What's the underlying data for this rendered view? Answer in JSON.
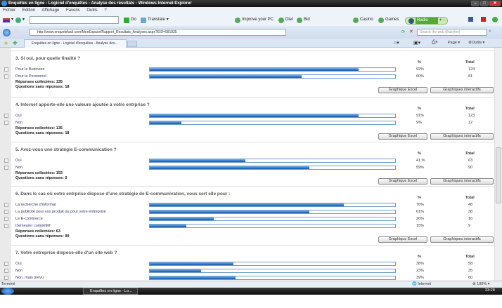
{
  "window": {
    "title": "Enquêtes en ligne - Logiciel d'enquêtes - Analyse des résultats - Windows Internet Explorer"
  },
  "menu": [
    "Fichier",
    "Edition",
    "Affichage",
    "Favoris",
    "Outils",
    "?"
  ],
  "toolbar": {
    "go": "Go",
    "translate": "Translate",
    "improve": "Improve your PC",
    "diet": "Diet",
    "bid": "Bid",
    "casino": "Casino",
    "games": "Games",
    "radio": "Radio"
  },
  "address": {
    "url": "http://www.enquetefacil.com/MonEspace/Rapport_Resultats_Analyses.aspx?EID=991835",
    "search_placeholder": "Search the web (Babylon)"
  },
  "tab": {
    "label": "Enquêtes en ligne - Logiciel d'enquêtes - Analyse des..."
  },
  "command": {
    "page": "Page",
    "outils": "Outils"
  },
  "labels": {
    "pct": "%",
    "total": "Total",
    "collected": "Réponses collectées:",
    "unanswered": "Questions sans réponses:",
    "excel": "Graphique Excel",
    "interactive": "Graphiques interactifs"
  },
  "questions": [
    {
      "title": "3. Si oui, pour quelle finalité ?",
      "collected": "135",
      "unanswered": "18",
      "options": [
        {
          "label": "Pour le Business",
          "pct": "92%",
          "total": "124",
          "fill": 0.85
        },
        {
          "label": "Pour le Personnel",
          "pct": "60%",
          "total": "81",
          "fill": 0.62
        }
      ]
    },
    {
      "title": "4. Internet apporte-elle une valeure ajoutée à votre entrprise ?",
      "collected": "135",
      "unanswered": "18",
      "options": [
        {
          "label": "Oui",
          "pct": "91%",
          "total": "123",
          "fill": 0.85
        },
        {
          "label": "Non",
          "pct": "9%",
          "total": "12",
          "fill": 0.13
        }
      ]
    },
    {
      "title": "5. Avez-vous une stratégie E-communication ?",
      "collected": "153",
      "unanswered": "0",
      "options": [
        {
          "label": "Oui",
          "pct": "41 %",
          "total": "63",
          "fill": 0.39
        },
        {
          "label": "Non",
          "pct": "59%",
          "total": "90",
          "fill": 0.65
        }
      ]
    },
    {
      "title": "6. Dans le cas où votre entrprise dispose d'une stratégie de E-communivation, vous sert elle pour :",
      "collected": "63",
      "unanswered": "90",
      "options": [
        {
          "label": "La recherche d'informat",
          "pct": "76%",
          "total": "48",
          "fill": 0.79
        },
        {
          "label": "La publicité pour vos produit ou pour votre entreprise",
          "pct": "61%",
          "total": "38",
          "fill": 0.65
        },
        {
          "label": "Le E-commerce",
          "pct": "26%",
          "total": "16",
          "fill": 0.26
        },
        {
          "label": "Demeurer compétitif",
          "pct": "15%",
          "total": "9",
          "fill": 0.15
        }
      ]
    },
    {
      "title": "7. Votre entreprise dispose-elle d'un site web ?",
      "collected": "",
      "unanswered": "",
      "options": [
        {
          "label": "Oui",
          "pct": "38%",
          "total": "58",
          "fill": 0.34
        },
        {
          "label": "Non",
          "pct": "23%",
          "total": "35",
          "fill": 0.21
        },
        {
          "label": "Non, mais prévu",
          "pct": "39%",
          "total": "60",
          "fill": 0.35
        }
      ]
    }
  ],
  "status": {
    "text": "Terminé",
    "zone": "Internet",
    "zoom": "100%"
  },
  "taskbar": {
    "task": "Enquêtes en ligne - Lo...",
    "clock": "23:28"
  }
}
